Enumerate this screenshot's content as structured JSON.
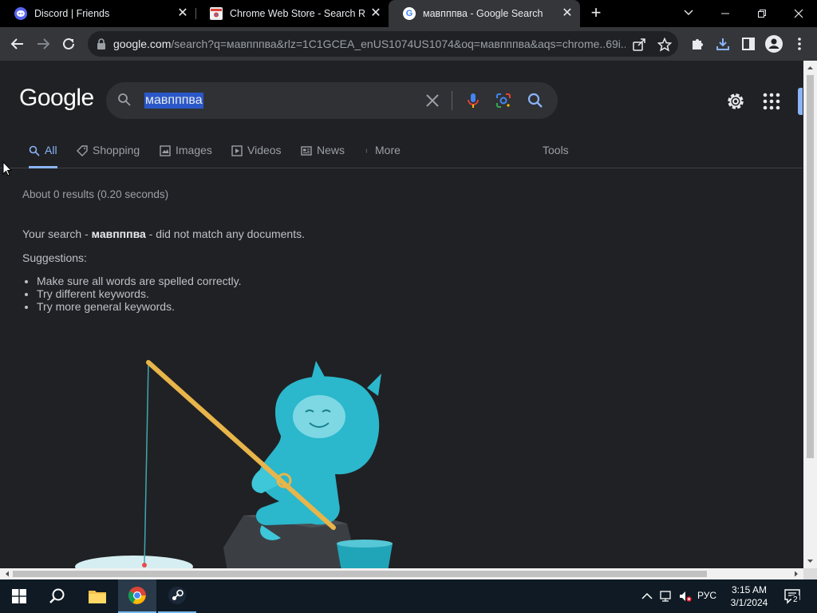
{
  "browser": {
    "tabs": [
      {
        "title": "Discord | Friends",
        "icon": "discord-icon",
        "active": false
      },
      {
        "title": "Chrome Web Store - Search Resu",
        "icon": "chrome-web-store-icon",
        "active": false
      },
      {
        "title": "мавпппва - Google Search",
        "icon": "google-g-icon",
        "active": true
      }
    ],
    "url_host": "google.com",
    "url_rest": "/search?q=мавпппва&rlz=1C1GCEA_enUS1074US1074&oq=мавпппва&aqs=chrome..69i..."
  },
  "google": {
    "logo": "Google",
    "query": "мавпппва",
    "tabs": {
      "all": "All",
      "shopping": "Shopping",
      "images": "Images",
      "videos": "Videos",
      "news": "News",
      "more": "More",
      "tools": "Tools"
    },
    "stats": "About 0 results (0.20 seconds)",
    "nomatch_prefix": "Your search - ",
    "nomatch_query": "мавпппва",
    "nomatch_suffix": " - did not match any documents.",
    "suggestions_title": "Suggestions:",
    "suggestions": [
      "Make sure all words are spelled correctly.",
      "Try different keywords.",
      "Try more general keywords."
    ]
  },
  "taskbar": {
    "language": "РУС",
    "time": "3:15 AM",
    "date": "3/1/2024",
    "notification_count": "2"
  },
  "colors": {
    "accent": "#8ab4f8",
    "page_bg": "#202124",
    "selection": "#2a58c8"
  }
}
